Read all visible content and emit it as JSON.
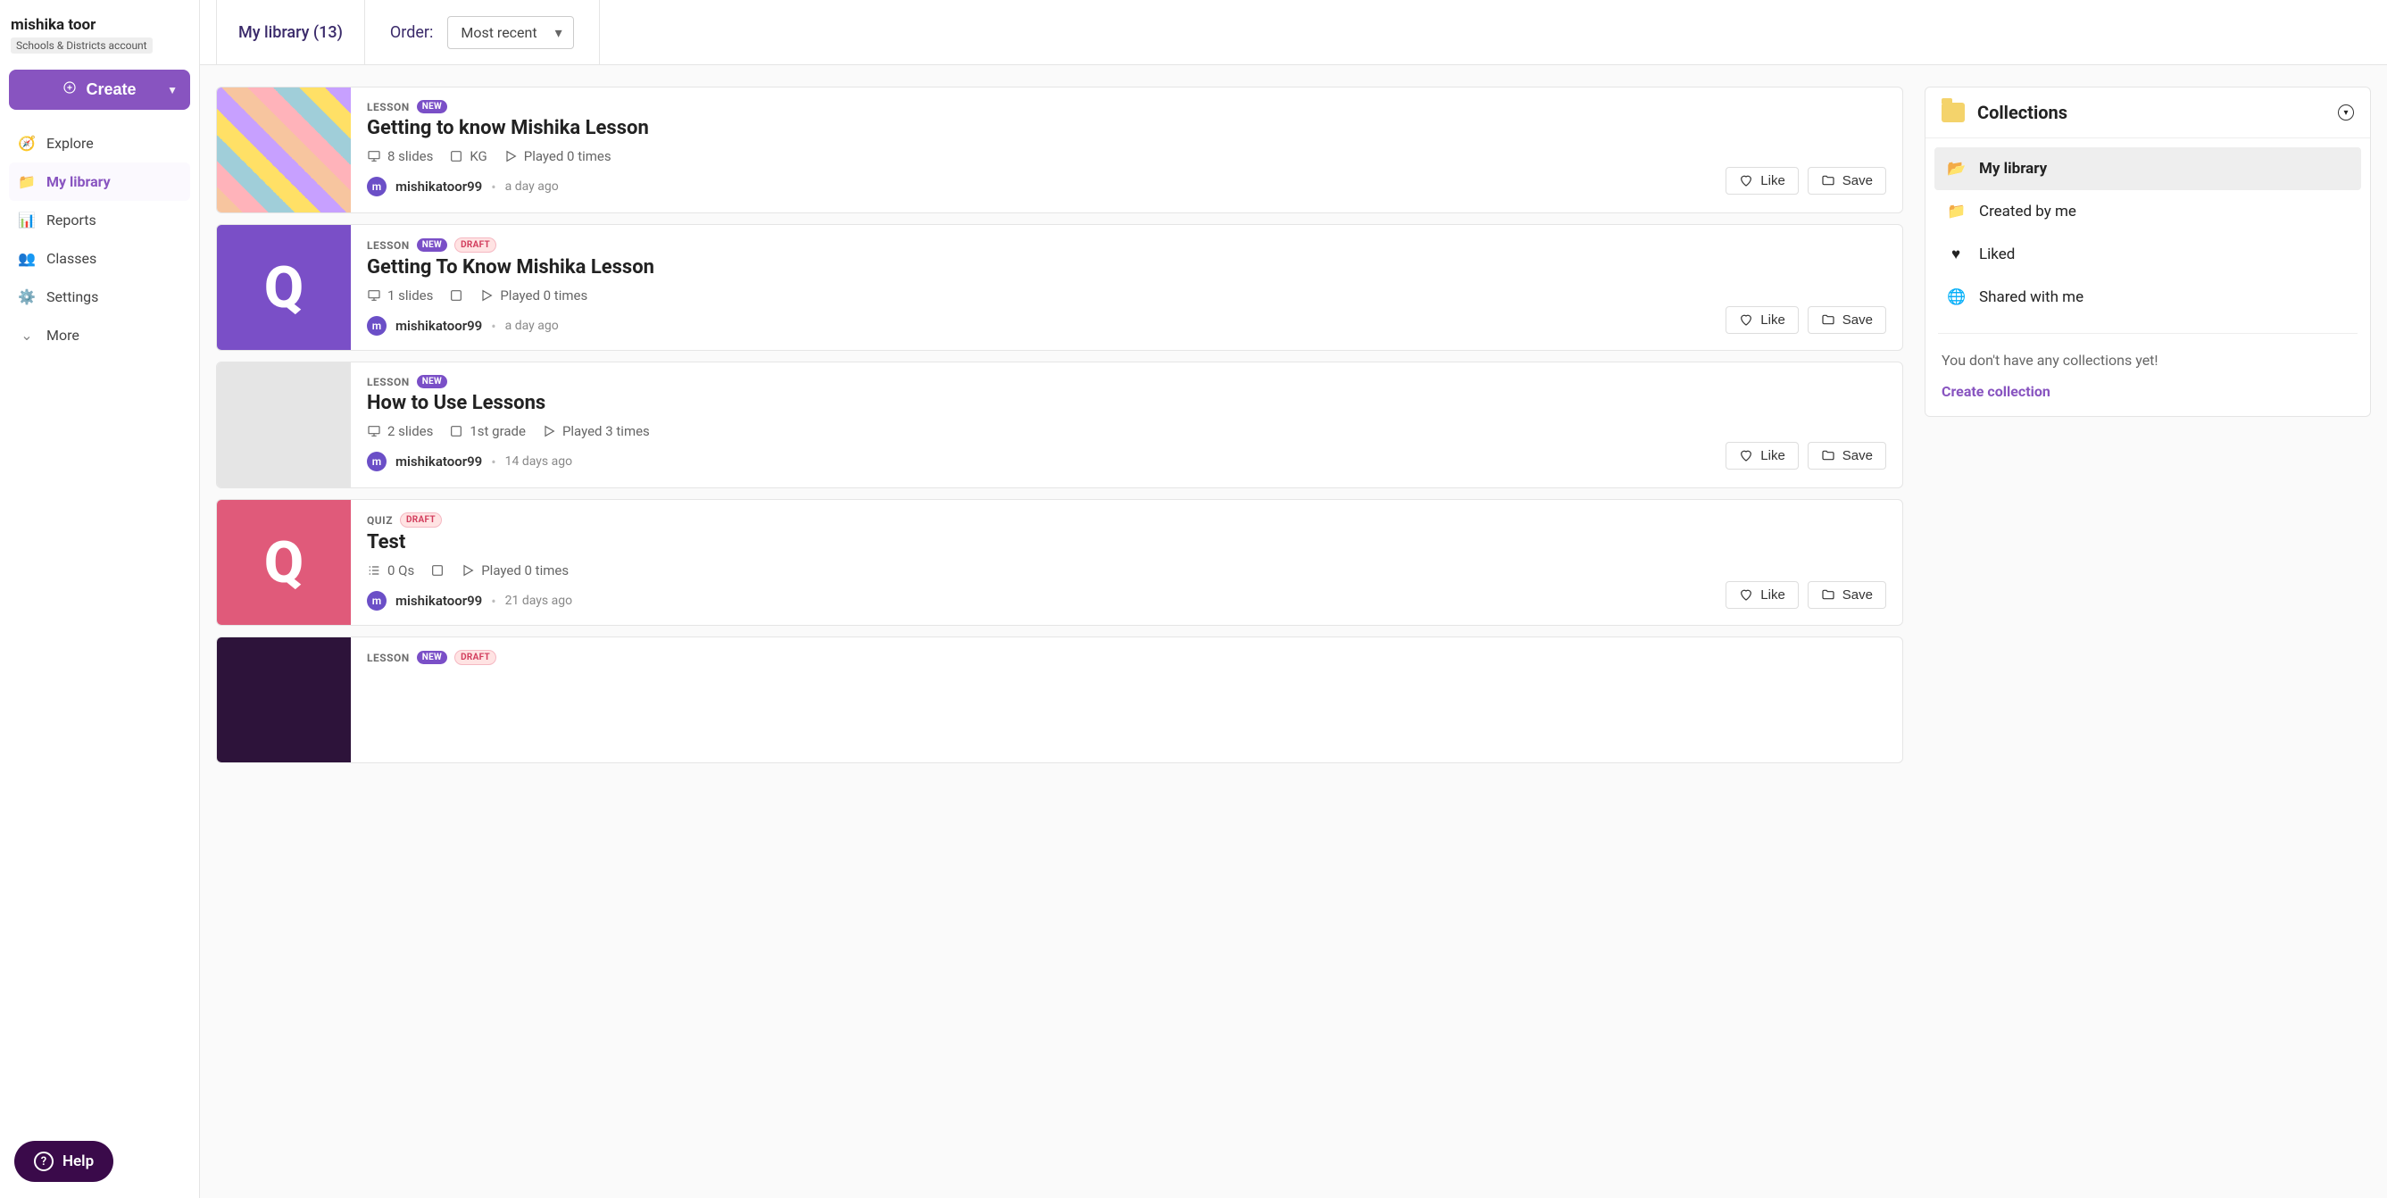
{
  "user": {
    "name": "mishika toor",
    "account_type": "Schools & Districts account"
  },
  "sidebar": {
    "create_label": "Create",
    "items": [
      {
        "label": "Explore"
      },
      {
        "label": "My library"
      },
      {
        "label": "Reports"
      },
      {
        "label": "Classes"
      },
      {
        "label": "Settings"
      },
      {
        "label": "More"
      }
    ],
    "help_label": "Help"
  },
  "topbar": {
    "tab_label": "My library (13)",
    "order_label": "Order:",
    "order_value": "Most recent"
  },
  "actions": {
    "like": "Like",
    "save": "Save"
  },
  "items": [
    {
      "type": "LESSON",
      "new": true,
      "draft": false,
      "title": "Getting to know Mishika Lesson",
      "slides": "8 slides",
      "grade": "KG",
      "plays": "Played 0 times",
      "author": "mishikatoor99",
      "time": "a day ago",
      "thumb_class": "th-people"
    },
    {
      "type": "LESSON",
      "new": true,
      "draft": true,
      "title": "Getting To Know Mishika Lesson",
      "slides": "1 slides",
      "grade": "",
      "plays": "Played 0 times",
      "author": "mishikatoor99",
      "time": "a day ago",
      "thumb_class": "th-purple"
    },
    {
      "type": "LESSON",
      "new": true,
      "draft": false,
      "title": "How to Use Lessons",
      "slides": "2 slides",
      "grade": "1st grade",
      "plays": "Played 3 times",
      "author": "mishikatoor99",
      "time": "14 days ago",
      "thumb_class": "th-grey"
    },
    {
      "type": "QUIZ",
      "new": false,
      "draft": true,
      "title": "Test",
      "slides": "0 Qs",
      "grade": "",
      "plays": "Played 0 times",
      "author": "mishikatoor99",
      "time": "21 days ago",
      "thumb_class": "th-pink"
    },
    {
      "type": "LESSON",
      "new": true,
      "draft": true,
      "title": "",
      "slides": "",
      "grade": "",
      "plays": "",
      "author": "",
      "time": "",
      "thumb_class": "th-dark"
    }
  ],
  "collections": {
    "title": "Collections",
    "items": [
      {
        "label": "My library"
      },
      {
        "label": "Created by me"
      },
      {
        "label": "Liked"
      },
      {
        "label": "Shared with me"
      }
    ],
    "empty_text": "You don't have any collections yet!",
    "create_label": "Create collection"
  }
}
